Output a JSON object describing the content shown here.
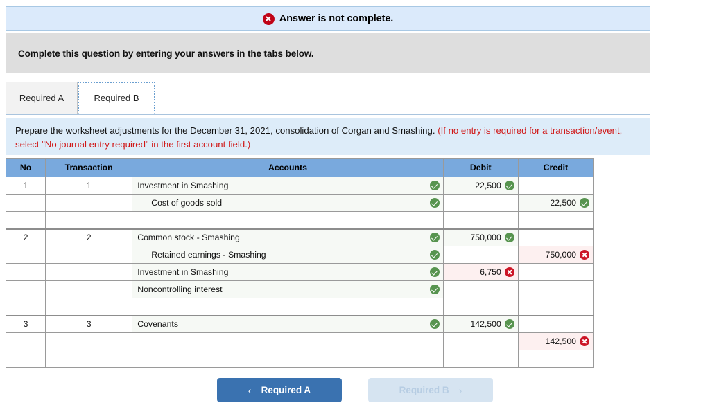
{
  "alert": {
    "icon": "error-x-circle-icon",
    "message": "Answer is not complete."
  },
  "instruction_bar": {
    "text": "Complete this question by entering your answers in the tabs below."
  },
  "tabs": [
    {
      "id": "required-a",
      "label": "Required A",
      "active": false
    },
    {
      "id": "required-b",
      "label": "Required B",
      "active": true
    }
  ],
  "question": {
    "main_text": "Prepare the worksheet adjustments for the December 31, 2021, consolidation of Corgan and Smashing.",
    "note_text": "(If no entry is required for a transaction/event, select \"No journal entry required\" in the first account field.)"
  },
  "table": {
    "columns": [
      "No",
      "Transaction",
      "Accounts",
      "Debit",
      "Credit"
    ],
    "rows": [
      {
        "no": "1",
        "transaction": "1",
        "account": "Investment in Smashing",
        "indent": false,
        "account_status": "ok",
        "debit": "22,500",
        "debit_status": "ok",
        "credit": "",
        "credit_status": "none",
        "group_start": false
      },
      {
        "no": "",
        "transaction": "",
        "account": "Cost of goods sold",
        "indent": true,
        "account_status": "ok",
        "debit": "",
        "debit_status": "none",
        "credit": "22,500",
        "credit_status": "ok",
        "group_start": false
      },
      {
        "no": "",
        "transaction": "",
        "account": "",
        "indent": false,
        "account_status": "none",
        "debit": "",
        "debit_status": "none",
        "credit": "",
        "credit_status": "none",
        "group_start": false
      },
      {
        "no": "2",
        "transaction": "2",
        "account": "Common stock - Smashing",
        "indent": false,
        "account_status": "ok",
        "debit": "750,000",
        "debit_status": "ok",
        "credit": "",
        "credit_status": "none",
        "group_start": true
      },
      {
        "no": "",
        "transaction": "",
        "account": "Retained earnings - Smashing",
        "indent": true,
        "account_status": "ok",
        "debit": "",
        "debit_status": "none",
        "credit": "750,000",
        "credit_status": "bad",
        "group_start": false
      },
      {
        "no": "",
        "transaction": "",
        "account": "Investment in Smashing",
        "indent": false,
        "account_status": "ok",
        "debit": "6,750",
        "debit_status": "bad",
        "credit": "",
        "credit_status": "none",
        "group_start": false
      },
      {
        "no": "",
        "transaction": "",
        "account": "Noncontrolling interest",
        "indent": false,
        "account_status": "ok",
        "debit": "",
        "debit_status": "none",
        "credit": "",
        "credit_status": "none",
        "group_start": false
      },
      {
        "no": "",
        "transaction": "",
        "account": "",
        "indent": false,
        "account_status": "none",
        "debit": "",
        "debit_status": "none",
        "credit": "",
        "credit_status": "none",
        "group_start": false
      },
      {
        "no": "3",
        "transaction": "3",
        "account": "Covenants",
        "indent": false,
        "account_status": "ok",
        "debit": "142,500",
        "debit_status": "ok",
        "credit": "",
        "credit_status": "none",
        "group_start": true
      },
      {
        "no": "",
        "transaction": "",
        "account": "",
        "indent": false,
        "account_status": "none",
        "debit": "",
        "debit_status": "none",
        "credit": "142,500",
        "credit_status": "bad",
        "group_start": false
      },
      {
        "no": "",
        "transaction": "",
        "account": "",
        "indent": false,
        "account_status": "none",
        "debit": "",
        "debit_status": "none",
        "credit": "",
        "credit_status": "none",
        "group_start": false
      }
    ]
  },
  "footer_nav": {
    "prev": {
      "label": "Required A",
      "chevron": "chevron-left-icon",
      "enabled": true
    },
    "next": {
      "label": "Required B",
      "chevron": "chevron-right-icon",
      "enabled": false
    }
  },
  "colors": {
    "alert_bg": "#dbeafb",
    "alert_border": "#a8c8e4",
    "instruction_bg": "#dedede",
    "question_bg": "#ddecf9",
    "table_header_bg": "#79a9dd",
    "ok_cell_bg": "#f6f9f5",
    "bad_cell_bg": "#fdf0f0",
    "check_green": "#57944f",
    "cross_red": "#cc1526",
    "note_red": "#d01818",
    "primary_button": "#3a72b0",
    "disabled_button": "#d6e4f1"
  }
}
